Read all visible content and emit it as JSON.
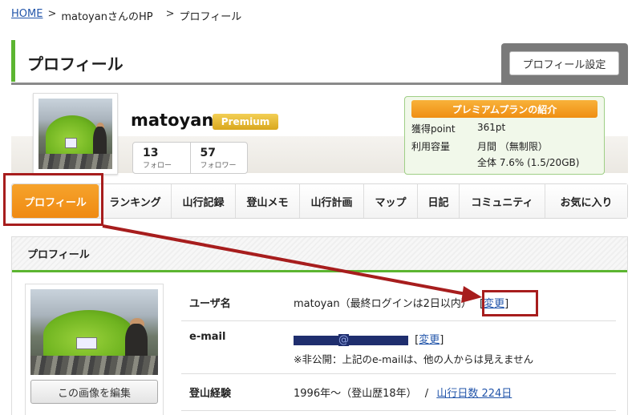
{
  "breadcrumb": {
    "home": "HOME",
    "sep1": ">",
    "site": "matoyanさんのHP",
    "sep2": ">",
    "current": "プロフィール"
  },
  "header": {
    "title": "プロフィール",
    "settings_button": "プロフィール設定"
  },
  "profile": {
    "username": "matoyan",
    "badge": "Premium",
    "follow_count": "13",
    "follow_label": "フォロー",
    "follower_count": "57",
    "follower_label": "フォロワー"
  },
  "plan": {
    "title": "プレミアムプランの紹介",
    "points_label": "獲得point",
    "points_value": "361pt",
    "storage_label": "利用容量",
    "storage_value": "月間 （無制限）",
    "storage_total": "全体 7.6% (1.5/20GB)"
  },
  "tabs": [
    {
      "label": "プロフィール"
    },
    {
      "label": "ランキング"
    },
    {
      "label": "山行記録"
    },
    {
      "label": "登山メモ"
    },
    {
      "label": "山行計画"
    },
    {
      "label": "マップ"
    },
    {
      "label": "日記"
    },
    {
      "label": "コミュニティ"
    },
    {
      "label": "お気に入り"
    }
  ],
  "panel": {
    "title": "プロフィール",
    "edit_image_button": "この画像を編集",
    "rows": {
      "username_key": "ユーザ名",
      "username_value": "matoyan（最終ログインは2日以内）",
      "username_change": "変更",
      "email_key": "e-mail",
      "email_at": "@",
      "email_change": "変更",
      "email_note": "※非公開：上記のe-mailは、他の人からは見えません",
      "experience_key": "登山経験",
      "experience_value": "1996年〜（登山歴18年）",
      "experience_sep": "/",
      "experience_link": "山行日数 224日"
    }
  },
  "colors": {
    "accent_green": "#5cb531",
    "tab_active": "#ef8a12",
    "annotation_red": "#a71d1d",
    "link_blue": "#2255aa"
  }
}
